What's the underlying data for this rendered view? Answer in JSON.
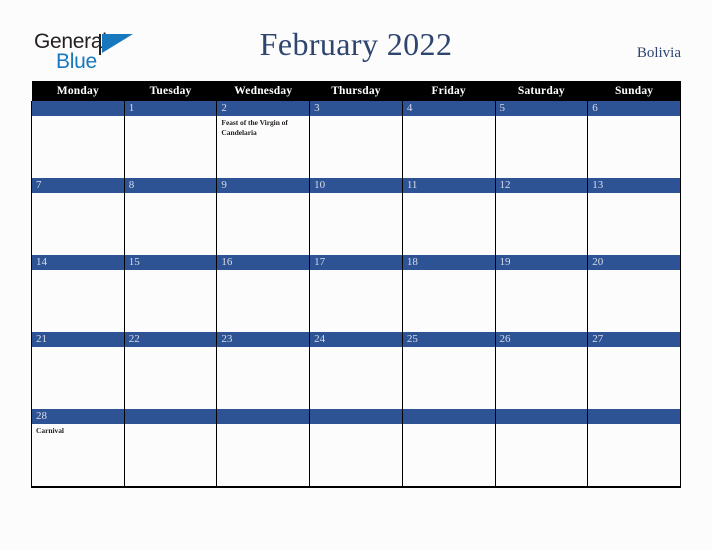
{
  "brand": {
    "name_part1": "General",
    "name_part2": "Blue"
  },
  "header": {
    "title": "February 2022",
    "country": "Bolivia"
  },
  "colors": {
    "header_bar": "#000000",
    "day_bar": "#2e5395",
    "title_text": "#2e4570",
    "logo_blue": "#1878be",
    "page_background": "#fcfcfd"
  },
  "calendar": {
    "weekday_headers": [
      "Monday",
      "Tuesday",
      "Wednesday",
      "Thursday",
      "Friday",
      "Saturday",
      "Sunday"
    ],
    "weeks": [
      {
        "days": [
          {
            "num": "",
            "event": ""
          },
          {
            "num": "1",
            "event": ""
          },
          {
            "num": "2",
            "event": "Feast of the Virgin of Candelaria"
          },
          {
            "num": "3",
            "event": ""
          },
          {
            "num": "4",
            "event": ""
          },
          {
            "num": "5",
            "event": ""
          },
          {
            "num": "6",
            "event": ""
          }
        ]
      },
      {
        "days": [
          {
            "num": "7",
            "event": ""
          },
          {
            "num": "8",
            "event": ""
          },
          {
            "num": "9",
            "event": ""
          },
          {
            "num": "10",
            "event": ""
          },
          {
            "num": "11",
            "event": ""
          },
          {
            "num": "12",
            "event": ""
          },
          {
            "num": "13",
            "event": ""
          }
        ]
      },
      {
        "days": [
          {
            "num": "14",
            "event": ""
          },
          {
            "num": "15",
            "event": ""
          },
          {
            "num": "16",
            "event": ""
          },
          {
            "num": "17",
            "event": ""
          },
          {
            "num": "18",
            "event": ""
          },
          {
            "num": "19",
            "event": ""
          },
          {
            "num": "20",
            "event": ""
          }
        ]
      },
      {
        "days": [
          {
            "num": "21",
            "event": ""
          },
          {
            "num": "22",
            "event": ""
          },
          {
            "num": "23",
            "event": ""
          },
          {
            "num": "24",
            "event": ""
          },
          {
            "num": "25",
            "event": ""
          },
          {
            "num": "26",
            "event": ""
          },
          {
            "num": "27",
            "event": ""
          }
        ]
      },
      {
        "days": [
          {
            "num": "28",
            "event": "Carnival"
          },
          {
            "num": "",
            "event": ""
          },
          {
            "num": "",
            "event": ""
          },
          {
            "num": "",
            "event": ""
          },
          {
            "num": "",
            "event": ""
          },
          {
            "num": "",
            "event": ""
          },
          {
            "num": "",
            "event": ""
          }
        ]
      }
    ]
  }
}
